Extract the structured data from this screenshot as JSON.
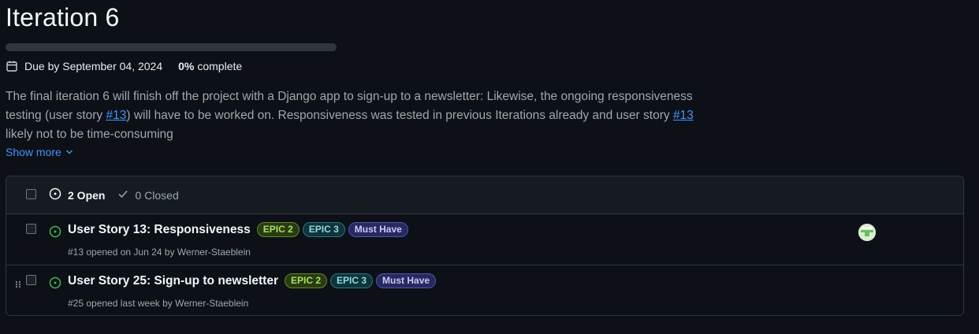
{
  "milestone": {
    "title": "Iteration 6",
    "progress_fraction": 0.0,
    "due_text": "Due by September 04, 2024",
    "percent": "0%",
    "percent_label": "complete",
    "description": {
      "part1": "The final iteration 6 will finish off the project with a Django app to sign-up to a newsletter: Likewise, the ongoing responsiveness testing (user story ",
      "link1": "#13",
      "part2": ") will have to be worked on. Responsiveness was tested in previous Iterations already and user story ",
      "link2": "#13",
      "part3": " likely not to be time-consuming"
    },
    "show_more": "Show more"
  },
  "issues": {
    "open_label": "2 Open",
    "closed_label": "0 Closed",
    "rows": [
      {
        "title": "User Story 13: Responsiveness",
        "labels": [
          {
            "text": "EPIC 2",
            "color": "#a2e35b",
            "bg": "#2a3a14",
            "border": "#5c8a25"
          },
          {
            "text": "EPIC 3",
            "color": "#8ddbe0",
            "bg": "#10343a",
            "border": "#2b7680"
          },
          {
            "text": "Must Have",
            "color": "#c8c8ff",
            "bg": "#262a5c",
            "border": "#4e55b0"
          }
        ],
        "subtitle": "#13 opened on Jun 24 by Werner-Staeblein"
      },
      {
        "title": "User Story 25: Sign-up to newsletter",
        "labels": [
          {
            "text": "EPIC 2",
            "color": "#a2e35b",
            "bg": "#2a3a14",
            "border": "#5c8a25"
          },
          {
            "text": "EPIC 3",
            "color": "#8ddbe0",
            "bg": "#10343a",
            "border": "#2b7680"
          },
          {
            "text": "Must Have",
            "color": "#c8c8ff",
            "bg": "#262a5c",
            "border": "#4e55b0"
          }
        ],
        "subtitle": "#25 opened last week by Werner-Staeblein"
      }
    ]
  },
  "colors": {
    "open_icon": "#3fb950",
    "link": "#4493f8",
    "background": "#0d1117"
  },
  "icons": [
    "calendar-icon",
    "chevron-down-icon",
    "issue-open-icon",
    "check-icon",
    "drag-handle-icon",
    "avatar"
  ]
}
